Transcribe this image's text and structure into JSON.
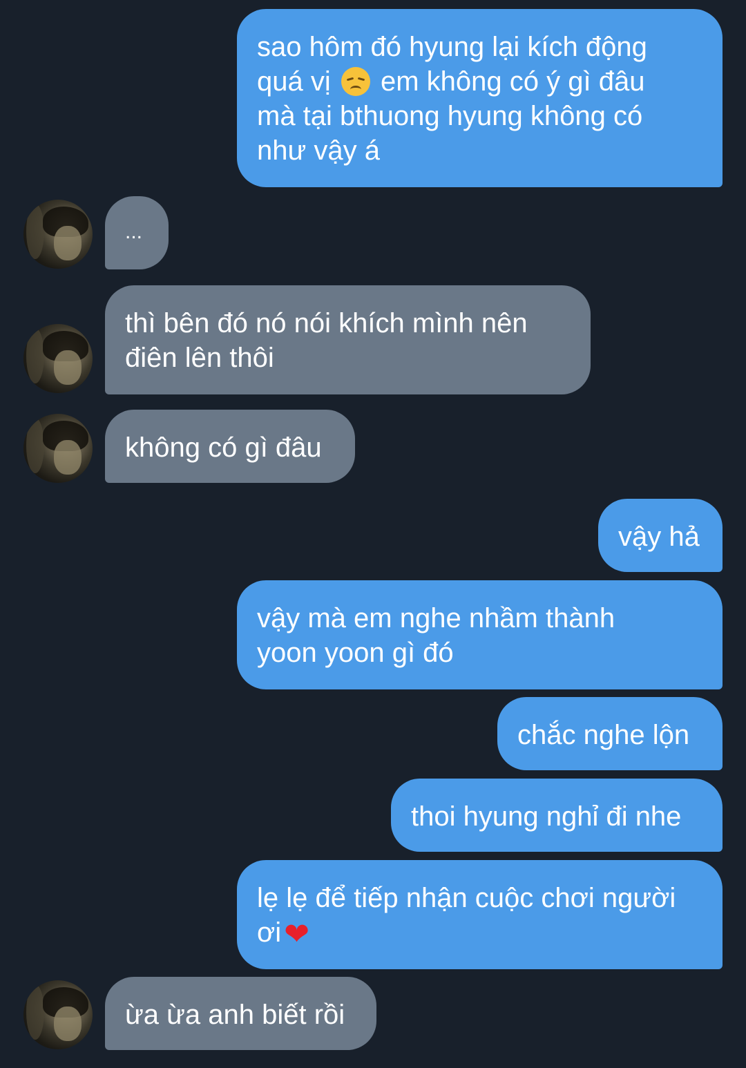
{
  "messages": [
    {
      "side": "sent",
      "lines": [
        "sao hôm đó hyung lại kích động",
        "quá vị",
        "em không có ý gì đâu",
        "mà tại bthuong hyung không có",
        "như vậy á"
      ],
      "emoji": "disappointed-face-emoji"
    },
    {
      "side": "received",
      "text": "..."
    },
    {
      "side": "received",
      "lines": [
        "thì bên đó nó nói khích mình nên",
        "điên lên thôi"
      ]
    },
    {
      "side": "received",
      "text": "không có gì đâu"
    },
    {
      "side": "sent",
      "text": "vậy hả"
    },
    {
      "side": "sent",
      "lines": [
        "vậy mà em nghe nhầm thành",
        "yoon yoon gì đó"
      ]
    },
    {
      "side": "sent",
      "text": "chắc nghe lộn"
    },
    {
      "side": "sent",
      "text": "thoi hyung nghỉ đi nhe"
    },
    {
      "side": "sent",
      "lines": [
        "lẹ lẹ để tiếp nhận cuộc chơi người",
        "ơi"
      ],
      "emoji": "red-heart-emoji",
      "heart_glyph": "❤"
    },
    {
      "side": "received",
      "text": "ừa ừa anh biết rồi"
    }
  ],
  "colors": {
    "background": "#18202b",
    "sent_bubble": "#4b9be8",
    "received_bubble": "#6a7888",
    "text": "#ffffff"
  }
}
